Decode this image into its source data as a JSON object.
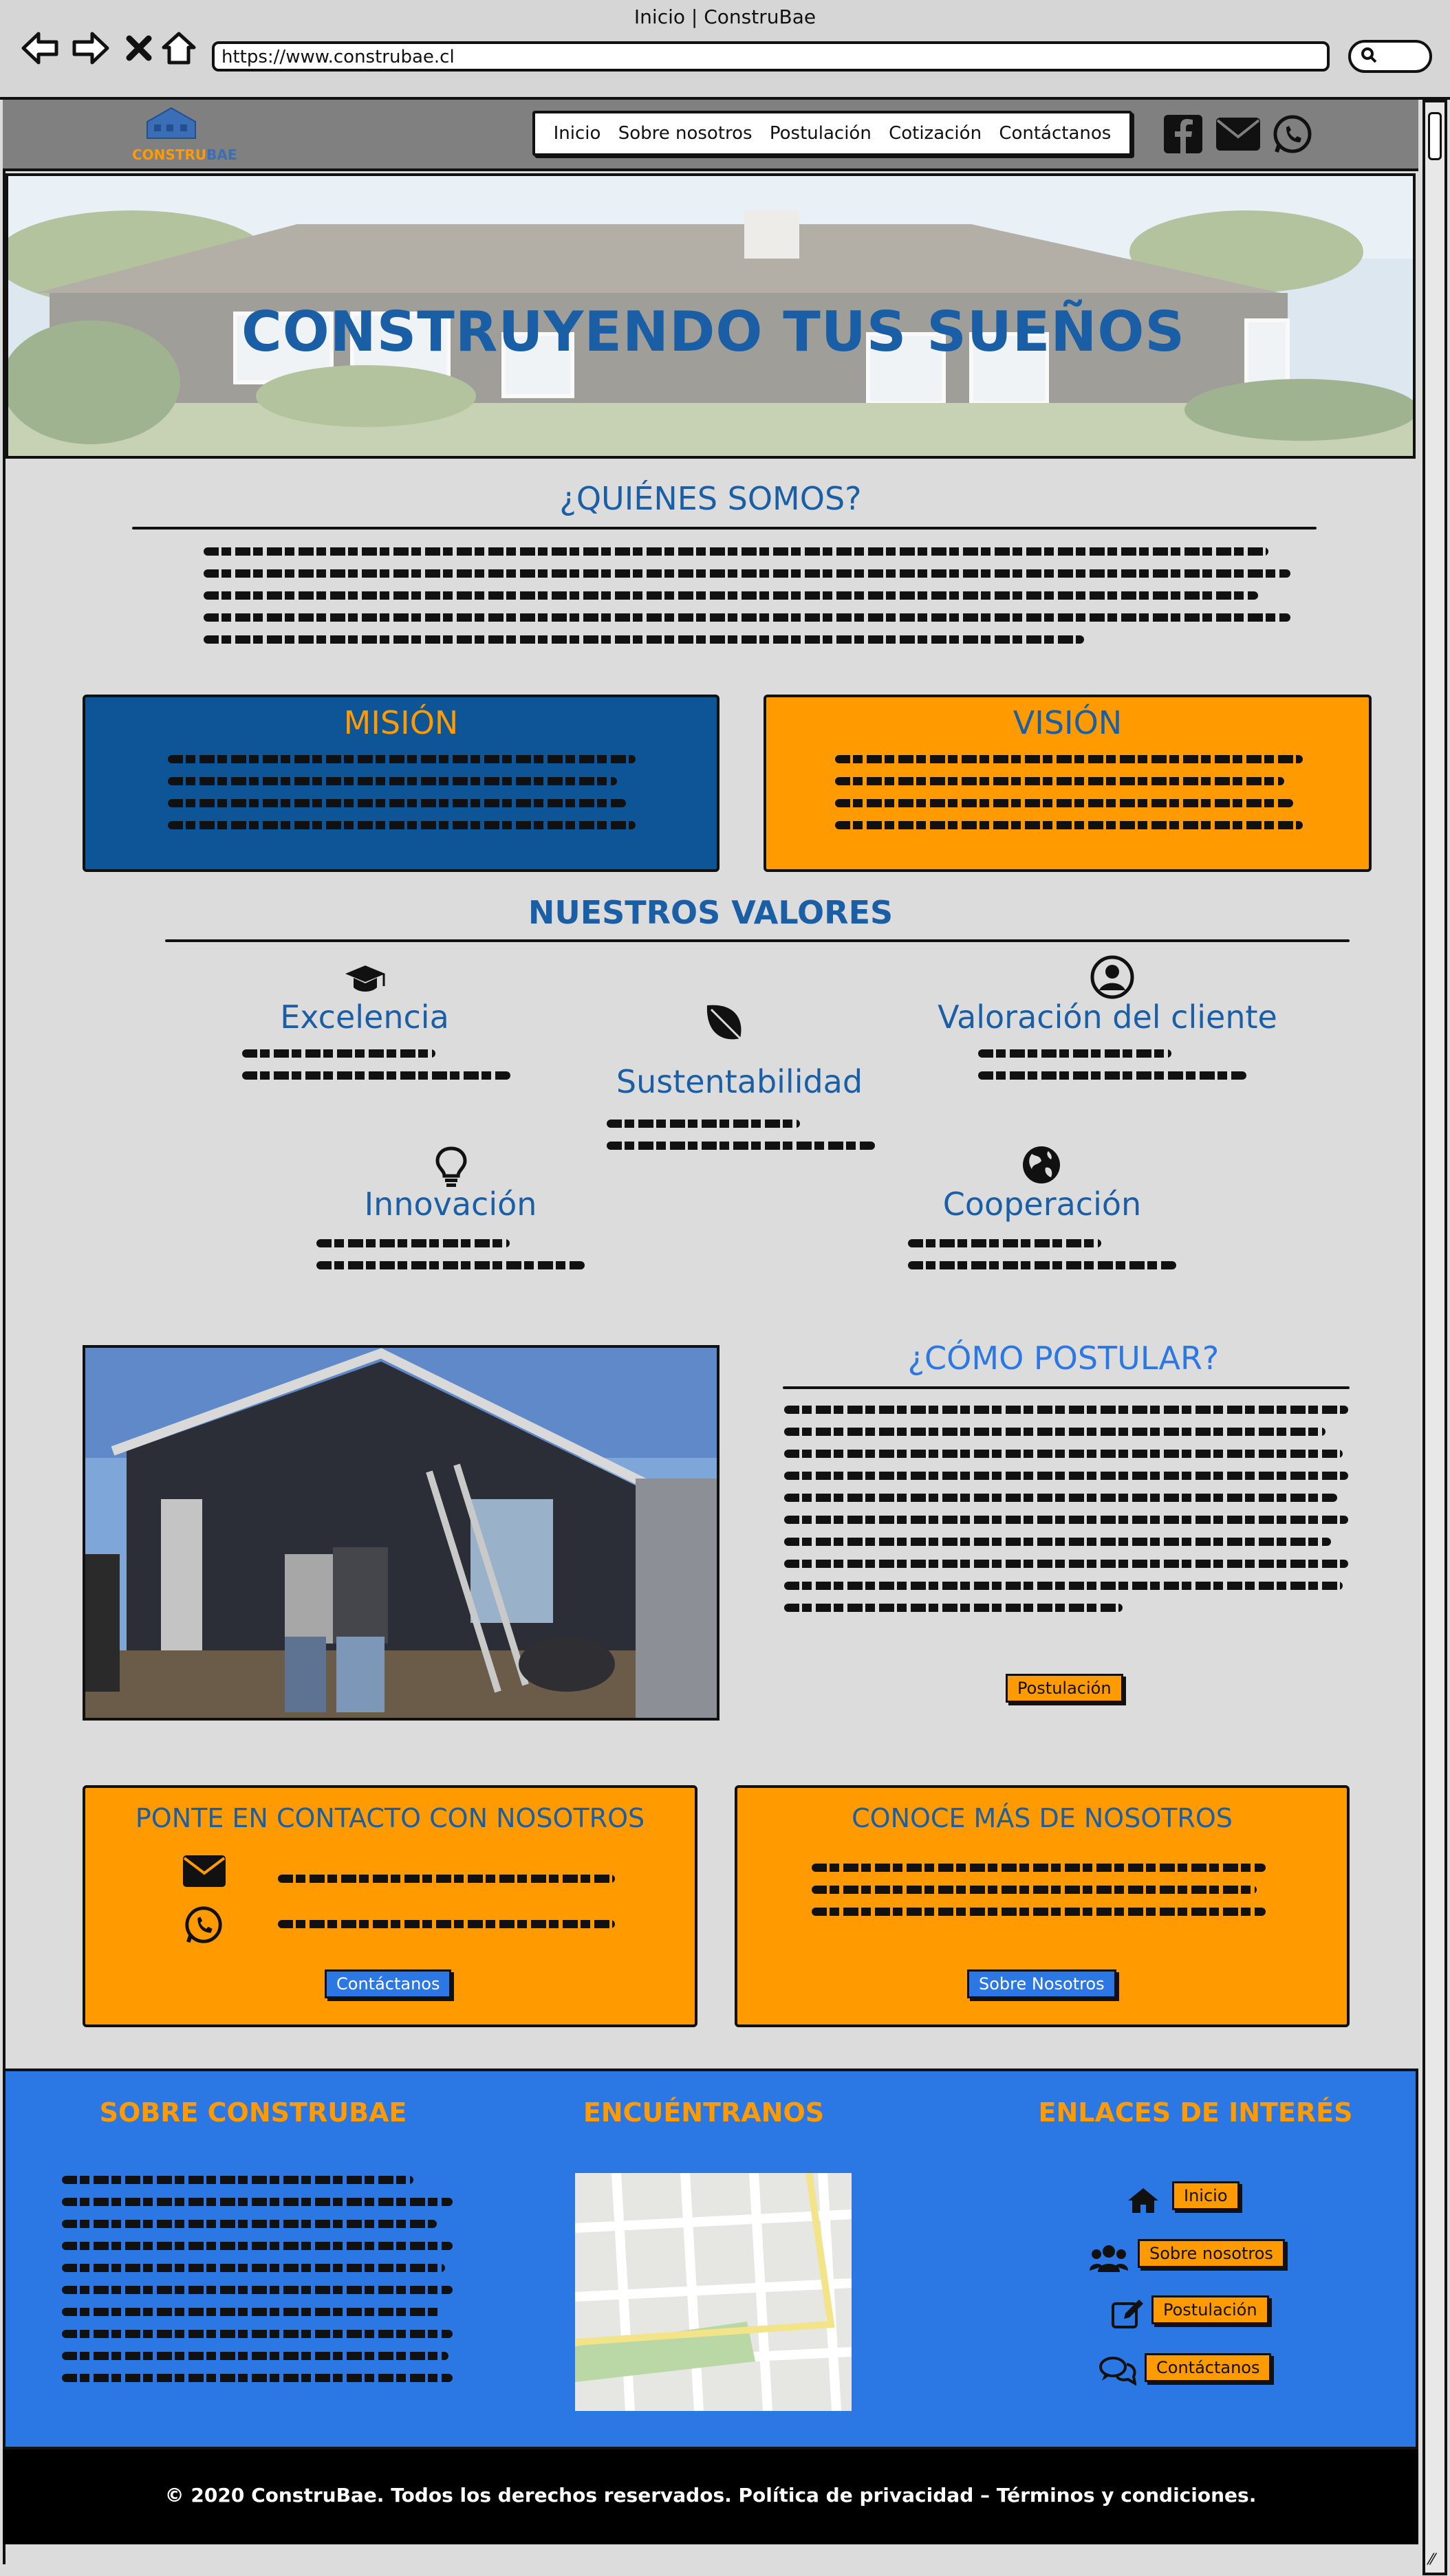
{
  "window": {
    "title": "Inicio | ConstruBae",
    "url": "https://www.construbae.cl"
  },
  "header": {
    "logo_text": "CONSTRU",
    "nav": [
      "Inicio",
      "Sobre nosotros",
      "Postulación",
      "Cotización",
      "Contáctanos"
    ],
    "social_icons": [
      "facebook-icon",
      "mail-icon",
      "whatsapp-icon"
    ]
  },
  "hero": {
    "title": "CONSTRUYENDO TUS SUEÑOS"
  },
  "quienes": {
    "title": "¿QUIÉNES SOMOS?"
  },
  "mision": {
    "title": "MISIÓN",
    "color": "#0d5596"
  },
  "vision": {
    "title": "VISIÓN",
    "color": "#ff9a00"
  },
  "valores": {
    "title": "NUESTROS VALORES",
    "items": [
      "Excelencia",
      "Sustentabilidad",
      "Valoración del cliente",
      "Innovación",
      "Cooperación"
    ]
  },
  "postular": {
    "title": "¿CÓMO POSTULAR?",
    "button": "Postulación"
  },
  "contacto": {
    "title": "PONTE EN CONTACTO CON NOSOTROS",
    "button": "Contáctanos"
  },
  "conoce": {
    "title": "CONOCE MÁS DE NOSOTROS",
    "button": "Sobre Nosotros"
  },
  "footer": {
    "about_title": "SOBRE CONSTRUBAE",
    "find_title": "ENCUÉNTRANOS",
    "links_title": "ENLACES DE INTERÉS",
    "links": [
      "Inicio",
      "Sobre nosotros",
      "Postulación",
      "Contáctanos"
    ],
    "copyright": "© 2020 ConstruBae. Todos los derechos reservados. Política de privacidad – Términos y condiciones."
  },
  "colors": {
    "blue": "#1a5fa6",
    "orange": "#ff9a00",
    "footer_blue": "#2b78e4"
  }
}
